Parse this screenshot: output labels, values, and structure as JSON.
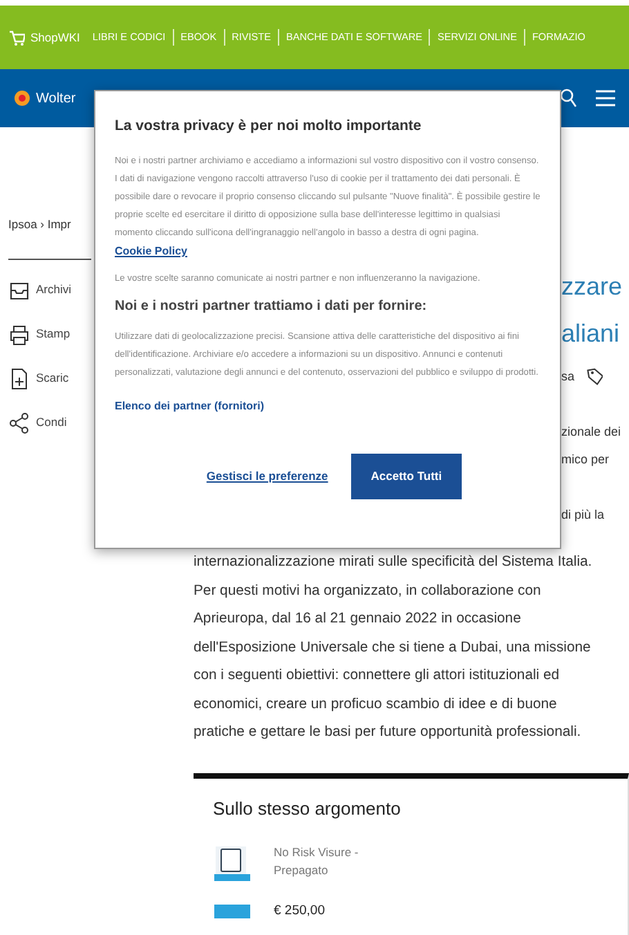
{
  "top_nav": {
    "items": [
      {
        "label": "ShopWKI",
        "kind": "brand"
      },
      {
        "label": "LIBRI E CODICI",
        "kind": "link"
      },
      {
        "label": "EBOOK",
        "kind": "link"
      },
      {
        "label": "RIVISTE",
        "kind": "link"
      },
      {
        "label": "BANCHE DATI E SOFTWARE",
        "kind": "link"
      },
      {
        "label": "SERVIZI ONLINE",
        "kind": "link"
      },
      {
        "label": "FORMAZIO",
        "kind": "link"
      }
    ]
  },
  "header": {
    "logo_text": "Wolter"
  },
  "breadcrumb": "Ipsoa › Impr",
  "actions": [
    {
      "label": "Archivi",
      "kind": "archive"
    },
    {
      "label": "Stamp",
      "kind": "print"
    },
    {
      "label": "Scaric",
      "kind": "download"
    },
    {
      "label": "Condi",
      "kind": "share"
    }
  ],
  "article": {
    "title_lines": [
      "zzare",
      "aliani"
    ],
    "meta": "sa",
    "lead_lines": [
      "zionale dei",
      "mico per",
      "di più la"
    ],
    "body": "internazionalizzazione mirati sulle specificità del Sistema Italia. Per questi motivi ha organizzato, in collaborazione con Aprieuropa, dal 16 al 21 gennaio 2022 in occasione dell'Esposizione Universale che si tiene a Dubai, una missione con i seguenti obiettivi: connettere gli attori istituzionali ed economici, creare un proficuo scambio di idee e di buone pratiche e gettare le basi per future opportunità professionali."
  },
  "related": {
    "title": "Sullo stesso argomento",
    "items": [
      {
        "title": "No Risk Visure - Prepagato",
        "price": "€ 250,00"
      }
    ]
  },
  "cookie_dialog": {
    "title": "La vostra privacy è per noi molto importante",
    "intro": "Noi e i nostri partner archiviamo e accediamo a informazioni sul vostro dispositivo con il vostro consenso. I dati di navigazione vengono raccolti attraverso l'uso di cookie per il trattamento dei dati personali. È possibile dare o revocare il proprio consenso cliccando sul pulsante \"Nuove finalità\". È possibile gestire le proprie scelte ed esercitare il diritto di opposizione sulla base dell'interesse legittimo in qualsiasi momento cliccando sull'icona dell'ingranaggio nell'angolo in basso a destra di ogni pagina.",
    "policy_link": "Cookie Policy",
    "note": "Le vostre scelte saranno comunicate ai nostri partner e non influenzeranno la navigazione.",
    "purposes_title": "Noi e i nostri partner trattiamo i dati per fornire:",
    "purposes": "Utilizzare dati di geolocalizzazione precisi. Scansione attiva delle caratteristiche del dispositivo ai fini dell'identificazione. Archiviare e/o accedere a informazioni su un dispositivo. Annunci e contenuti personalizzati, valutazione degli annunci e del contenuto, osservazioni del pubblico e sviluppo di prodotti.",
    "partners_link": "Elenco dei partner (fornitori)",
    "buttons": [
      {
        "label": "Gestisci le preferenze",
        "kind": "link"
      },
      {
        "label": "Accetto Tutti",
        "kind": "primary"
      }
    ]
  }
}
